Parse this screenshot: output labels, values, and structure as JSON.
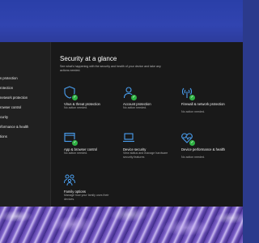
{
  "sidebar": {
    "items": [
      {
        "label": "s protection"
      },
      {
        "label": "rotection"
      },
      {
        "label": "network protection"
      },
      {
        "label": "rowser control"
      },
      {
        "label": "curity"
      },
      {
        "label": "rformance & health"
      },
      {
        "label": "tions"
      }
    ]
  },
  "main": {
    "title": "Security at a glance",
    "subtitle": "See what's happening with the security and health of your device and take any actions needed.",
    "tiles": [
      {
        "title": "Virus & threat protection",
        "status": "No action needed.",
        "icon": "shield-virus-icon"
      },
      {
        "title": "Account protection",
        "status": "No action needed.",
        "icon": "person-icon"
      },
      {
        "title": "Firewall & network protection",
        "status": "No action needed.",
        "icon": "wifi-antenna-icon"
      },
      {
        "title": "App & browser control",
        "status": "No action needed.",
        "icon": "app-window-icon"
      },
      {
        "title": "Device security",
        "status": "View status and manage hardware security features",
        "icon": "laptop-icon"
      },
      {
        "title": "Device performance & health",
        "status": "No action needed.",
        "icon": "heart-pulse-icon"
      },
      {
        "title": "Family options",
        "status": "Manage how your family uses their devices.",
        "icon": "family-icon"
      }
    ]
  },
  "colors": {
    "accent": "#4a9ff0",
    "ok_badge": "#2fb344",
    "window_bg": "#191919",
    "sidebar_bg": "#202020"
  }
}
